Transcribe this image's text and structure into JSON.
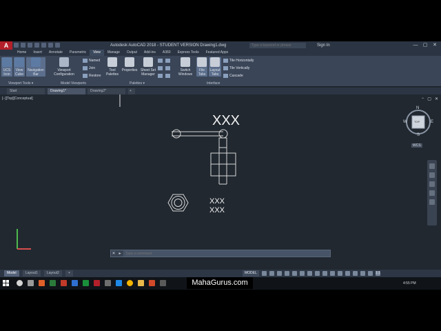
{
  "app": {
    "logo_letter": "A",
    "title": "Autodesk AutoCAD 2018 - STUDENT VERSION   Drawing1.dwg",
    "search_placeholder": "Type a keyword or phrase",
    "sign_in": "Sign In",
    "minimize": "—",
    "maximize": "▢",
    "close": "✕"
  },
  "ribbon_tabs": [
    "Home",
    "Insert",
    "Annotate",
    "Parametric",
    "View",
    "Manage",
    "Output",
    "Add-ins",
    "A360",
    "Express Tools",
    "Featured Apps"
  ],
  "ribbon_active_tab": "View",
  "ribbon": {
    "ucs_icon": "UCS Icon",
    "view_cube": "View Cube",
    "navigation_bar": "Navigation Bar",
    "viewport_configuration": "Viewport Configuration",
    "named": "Named",
    "join": "Join",
    "restore": "Restore",
    "tool_palettes": "Tool Palettes",
    "properties": "Properties",
    "sheet_set_manager": "Sheet Set Manager",
    "switch_windows": "Switch Windows",
    "file_tabs": "File Tabs",
    "layout_tabs": "Layout Tabs",
    "tile_horizontally": "Tile Horizontally",
    "tile_vertically": "Tile Vertically",
    "cascade": "Cascade",
    "panel_viewport_tools": "Viewport Tools ▾",
    "panel_model_viewports": "Model Viewports",
    "panel_palettes": "Palettes ▾",
    "panel_interface": "Interface"
  },
  "doc_tabs": [
    {
      "label": "Start",
      "active": false
    },
    {
      "label": "Drawing1*",
      "active": true
    },
    {
      "label": "Drawing2*",
      "active": false
    }
  ],
  "new_tab": "+",
  "viewport": {
    "label": "[−][Top][Conceptual]",
    "texts": {
      "big": "XXX",
      "small1": "XXX",
      "small2": "XXX"
    },
    "viewcube": {
      "top": "TOP",
      "n": "N",
      "s": "S",
      "e": "E",
      "w": "W",
      "wcs": "WCS"
    },
    "controls": [
      "−",
      "▢",
      "✕"
    ]
  },
  "command": {
    "close": "✕",
    "prompt": "▸",
    "placeholder": "Type a command"
  },
  "layout_tabs": [
    {
      "label": "Model",
      "active": true
    },
    {
      "label": "Layout1",
      "active": false
    },
    {
      "label": "Layout2",
      "active": false
    }
  ],
  "layout_add": "+",
  "status": {
    "model": "MODEL",
    "scale": "1:1"
  },
  "taskbar": {
    "time": "4:55 PM"
  },
  "watermark": "MahaGurus.com",
  "colors": {
    "accent": "#b3202a",
    "drawing_bg": "#212830",
    "lines": "#d8d8d8"
  }
}
